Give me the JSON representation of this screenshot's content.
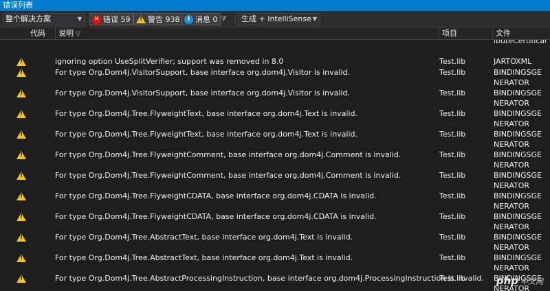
{
  "window": {
    "title": "错误列表"
  },
  "toolbar": {
    "scope": "整个解决方案",
    "errors_label": "错误 59",
    "warnings_label": "警告 938",
    "messages_label": "消息 0",
    "build_filter": "生成 + IntelliSense"
  },
  "columns": {
    "code": "代码",
    "description": "说明",
    "project": "项目",
    "file": "文件"
  },
  "partial_row": {
    "file": "ibuteCertificate.cs"
  },
  "rows": [
    {
      "description": "ignoring option UseSplitVerifier; support was removed in 8.0",
      "project": "Test.lib",
      "file": "JARTOXML"
    },
    {
      "description": "For type Org.Dom4j.VisitorSupport, base interface org.dom4j.Visitor is invalid.",
      "project": "Test.lib",
      "file": "BINDINGSGENERATOR"
    },
    {
      "description": "For type Org.Dom4j.VisitorSupport, base interface org.dom4j.Visitor is invalid.",
      "project": "Test.lib",
      "file": "BINDINGSGENERATOR"
    },
    {
      "description": "For type Org.Dom4j.Tree.FlyweightText, base interface org.dom4j.Text is invalid.",
      "project": "Test.lib",
      "file": "BINDINGSGENERATOR"
    },
    {
      "description": "For type Org.Dom4j.Tree.FlyweightText, base interface org.dom4j.Text is invalid.",
      "project": "Test.lib",
      "file": "BINDINGSGENERATOR"
    },
    {
      "description": "For type Org.Dom4j.Tree.FlyweightComment, base interface org.dom4j.Comment is invalid.",
      "project": "Test.lib",
      "file": "BINDINGSGENERATOR"
    },
    {
      "description": "For type Org.Dom4j.Tree.FlyweightComment, base interface org.dom4j.Comment is invalid.",
      "project": "Test.lib",
      "file": "BINDINGSGENERATOR"
    },
    {
      "description": "For type Org.Dom4j.Tree.FlyweightCDATA, base interface org.dom4j.CDATA is invalid.",
      "project": "Test.lib",
      "file": "BINDINGSGENERATOR"
    },
    {
      "description": "For type Org.Dom4j.Tree.FlyweightCDATA, base interface org.dom4j.CDATA is invalid.",
      "project": "Test.lib",
      "file": "BINDINGSGENERATOR"
    },
    {
      "description": "For type Org.Dom4j.Tree.AbstractText, base interface org.dom4j.Text is invalid.",
      "project": "Test.lib",
      "file": "BINDINGSGENERATOR"
    },
    {
      "description": "For type Org.Dom4j.Tree.AbstractText, base interface org.dom4j.Text is invalid.",
      "project": "Test.lib",
      "file": "BINDINGSGENERATOR"
    },
    {
      "description": "For type Org.Dom4j.Tree.AbstractProcessingInstruction, base interface org.dom4j.ProcessingInstruction is invalid.",
      "project": "Test.lib",
      "file": "BINDINGSGENERATOR"
    }
  ],
  "watermark": {
    "brand": "php",
    "site": "中文网"
  },
  "icons": {
    "error": "error-circle-icon",
    "warning": "warning-triangle-icon",
    "info": "info-circle-icon",
    "filter": "funnel-icon"
  },
  "colors": {
    "titlebar": "#007acc",
    "background": "#1e1e1e",
    "warning": "#f5c518",
    "error": "#e51400",
    "info": "#1e8fd6"
  }
}
